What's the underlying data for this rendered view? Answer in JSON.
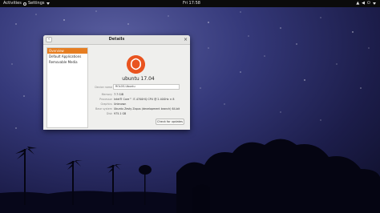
{
  "topbar": {
    "activities": "Activities",
    "app_menu": "Settings",
    "clock": "Fri 17:58"
  },
  "window": {
    "title": "Details",
    "sidebar": {
      "items": [
        {
          "label": "Overview",
          "active": true
        },
        {
          "label": "Default Applications",
          "active": false
        },
        {
          "label": "Removable Media",
          "active": false
        }
      ]
    },
    "overview": {
      "os_name": "ubuntu 17.04",
      "device_name_label": "Device name",
      "device_name_value": "ROLOS-Ubuntu",
      "rows": [
        {
          "label": "Memory",
          "value": "7.7 GiB"
        },
        {
          "label": "Processor",
          "value": "Intel® Core™ i7-4700HQ CPU @ 2.40GHz × 8"
        },
        {
          "label": "Graphics",
          "value": "Unknown"
        },
        {
          "label": "Base system",
          "value": "Ubuntu Zesty Zapus (development branch) 64-bit"
        },
        {
          "label": "Disk",
          "value": "975.1 GB"
        }
      ],
      "check_updates": "Check for updates"
    }
  },
  "colors": {
    "accent": "#e67e22",
    "ubuntu_logo": "#e95420"
  }
}
